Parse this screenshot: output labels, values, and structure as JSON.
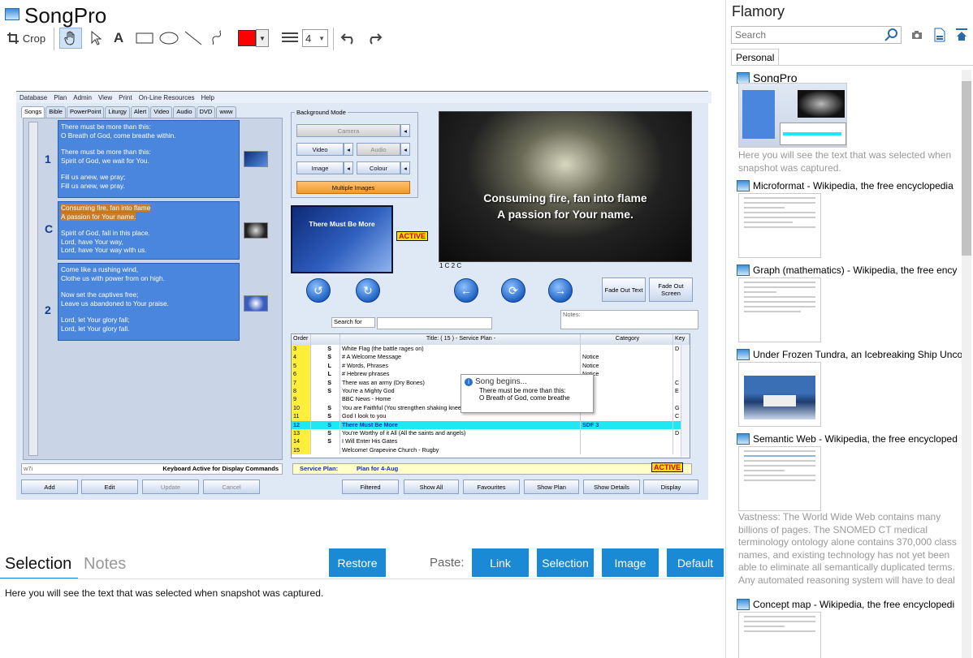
{
  "app": {
    "title": "SongPro"
  },
  "toolbar": {
    "crop_label": "Crop",
    "line_width": "4"
  },
  "colors": {
    "accent": "#1a8ad4",
    "pen_color": "#ff0000",
    "active_badge": "#ffdf00",
    "selected_row": "#1ee9f3"
  },
  "screenshot": {
    "menu": [
      "Database",
      "Plan",
      "Admin",
      "View",
      "Print",
      "On-Line Resources",
      "Help"
    ],
    "tabs": [
      "Songs",
      "Bible",
      "PowerPoint",
      "Liturgy",
      "Alert",
      "Video",
      "Audio",
      "DVD",
      "www"
    ],
    "verses": [
      {
        "label": "1",
        "lines": [
          "There must be more than this:",
          "O Breath of God, come breathe within.",
          "There must be more than this:",
          "Spirit of God, we wait for You.",
          "Fill us anew, we pray;",
          "Fill us anew, we pray."
        ]
      },
      {
        "label": "C",
        "lines": [
          "Consuming fire, fan into flame",
          "A passion for Your name.",
          "Spirit of God, fall in this place.",
          "Lord, have Your way,",
          "Lord, have Your way with us."
        ]
      },
      {
        "label": "2",
        "lines": [
          "Come like a rushing wind,",
          "Clothe us with power from on high.",
          "Now set the captives free;",
          "Leave us abandoned to Your praise.",
          "Lord, let Your glory fall;",
          "Lord, let Your glory fall."
        ]
      }
    ],
    "background_mode": {
      "title": "Background Mode",
      "camera": "Camera",
      "video": "Video",
      "audio": "Audio",
      "image": "Image",
      "colour": "Colour",
      "multiple": "Multiple Images"
    },
    "preview": {
      "line1": "Consuming fire, fan into flame",
      "line2": "A passion for Your name.",
      "caption": "1 C 2 C"
    },
    "slide_thumb": "There Must Be More",
    "active_label": "ACTIVE",
    "fade_text": "Fade Out Text",
    "fade_screen": "Fade Out Screen",
    "search_for": "Search for",
    "notes_label": "Notes:",
    "grid_headers": {
      "order": "Order",
      "title": "Title: ( 15 ) - Service Plan -",
      "category": "Category",
      "key": "Key"
    },
    "grid_rows": [
      {
        "order": "3",
        "type": "S",
        "title": "White Flag (the battle rages on)",
        "category": "",
        "key": "D"
      },
      {
        "order": "4",
        "type": "S",
        "title": "# A Welcome Message",
        "category": "Notice",
        "key": ""
      },
      {
        "order": "5",
        "type": "L",
        "title": "# Words, Phrases",
        "category": "Notice",
        "key": ""
      },
      {
        "order": "6",
        "type": "L",
        "title": "# Hebrew phrases",
        "category": "Notice",
        "key": ""
      },
      {
        "order": "7",
        "type": "S",
        "title": "There was an army (Dry Bones)",
        "category": "",
        "key": "C"
      },
      {
        "order": "8",
        "type": "S",
        "title": "You're a Mighty God",
        "category": "",
        "key": "E"
      },
      {
        "order": "9",
        "type": "",
        "title": "BBC News - Home",
        "category": "",
        "key": ""
      },
      {
        "order": "10",
        "type": "S",
        "title": "You are Faithful (You strengthen shaking knees)",
        "category": "",
        "key": "G"
      },
      {
        "order": "11",
        "type": "S",
        "title": "God I look to you",
        "category": "",
        "key": "C"
      },
      {
        "order": "12",
        "type": "S",
        "title": "There Must Be More",
        "category": "SDF 3",
        "key": ""
      },
      {
        "order": "13",
        "type": "S",
        "title": "You're Worthy of it All (All the saints and angels)",
        "category": "",
        "key": "D"
      },
      {
        "order": "14",
        "type": "S",
        "title": "I Will Enter His Gates",
        "category": "",
        "key": ""
      },
      {
        "order": "15",
        "type": "",
        "title": "Welcome! Grapevine Church - Rugby",
        "category": "",
        "key": ""
      }
    ],
    "tooltip": {
      "title": "Song begins...",
      "line1": "There must be more than this:",
      "line2": "O Breath of God, come breathe"
    },
    "status_left": "w7i",
    "status_keyboard": "Keyboard Active for Display Commands",
    "service_plan_label": "Service Plan:",
    "service_plan_value": "Plan for 4-Aug",
    "buttons": {
      "add": "Add",
      "edit": "Edit",
      "update": "Update",
      "cancel": "Cancel",
      "filtered": "Filtered",
      "show_all": "Show All",
      "favourites": "Favourites",
      "show_plan": "Show Plan",
      "show_details": "Show Details",
      "display": "Display"
    }
  },
  "bottom": {
    "tab_selection": "Selection",
    "tab_notes": "Notes",
    "restore": "Restore",
    "paste_label": "Paste:",
    "link": "Link",
    "selection": "Selection",
    "image": "Image",
    "default": "Default",
    "text": "Here you will see the text that was selected when snapshot was captured."
  },
  "flamory": {
    "title": "Flamory",
    "search_placeholder": "Search",
    "tab": "Personal",
    "items": [
      {
        "title": "SongPro",
        "desc": "Here you will see the text that was selected when snapshot was captured."
      },
      {
        "title": "Microformat - Wikipedia, the free encyclopedia"
      },
      {
        "title": "Graph (mathematics) - Wikipedia, the free ency"
      },
      {
        "title": "Under Frozen Tundra, an Icebreaking Ship Unco"
      },
      {
        "title": "Semantic Web - Wikipedia, the free encycloped",
        "desc": "Vastness: The World Wide Web contains many billions of pages. The SNOMED CT medical terminology ontology alone contains 370,000 class names, and existing technology has not yet been able to eliminate all semantically duplicated terms. Any automated reasoning system will have to deal with truly huge inputs."
      },
      {
        "title": "Concept map - Wikipedia, the free encyclopedi"
      }
    ]
  }
}
